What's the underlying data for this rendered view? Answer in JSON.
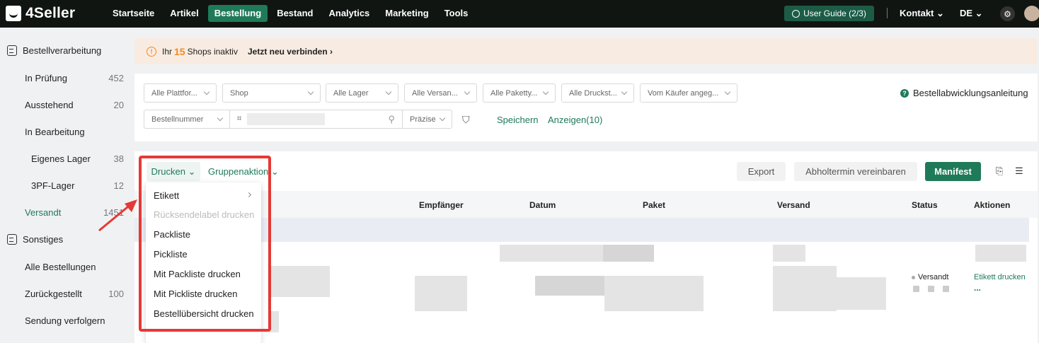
{
  "app": {
    "name": "4Seller"
  },
  "nav": {
    "items": [
      "Startseite",
      "Artikel",
      "Bestellung",
      "Bestand",
      "Analytics",
      "Marketing",
      "Tools"
    ],
    "active": "Bestellung"
  },
  "topbar": {
    "guide": "User Guide (2/3)",
    "contact": "Kontakt",
    "lang": "DE"
  },
  "sidebar": {
    "group1": "Bestellverarbeitung",
    "items": [
      {
        "label": "In Prüfung",
        "count": "452"
      },
      {
        "label": "Ausstehend",
        "count": "20"
      },
      {
        "label": "In Bearbeitung",
        "count": ""
      },
      {
        "label": "Eigenes Lager",
        "count": "38"
      },
      {
        "label": "3PF-Lager",
        "count": "12"
      },
      {
        "label": "Versandt",
        "count": "1451"
      }
    ],
    "group2": "Sonstiges",
    "items2": [
      "Alle Bestellungen",
      "Zurückgestellt",
      "Sendung verfolgern"
    ],
    "zurueck_count": "100"
  },
  "banner": {
    "prefix": "Ihr",
    "count": "15",
    "suffix": "Shops inaktiv",
    "link": "Jetzt neu verbinden"
  },
  "filters": {
    "row1": [
      "Alle Plattfor...",
      "Shop",
      "Alle Lager",
      "Alle Versan...",
      "Alle Paketty...",
      "Alle Druckst...",
      "Vom Käufer angeg..."
    ],
    "search_type": "Bestellnummer",
    "precision": "Präzise",
    "save": "Speichern",
    "show": "Anzeigen(10)",
    "guide": "Bestellabwicklungsanleitung"
  },
  "toolbar": {
    "print": "Drucken",
    "group": "Gruppenaktion",
    "export": "Export",
    "pickup": "Abholtermin vereinbaren",
    "manifest": "Manifest"
  },
  "table": {
    "headers": [
      "Empfänger",
      "Datum",
      "Paket",
      "Versand",
      "Status",
      "Aktionen"
    ],
    "row_status": "Versandt",
    "row_action": "Etikett drucken",
    "row_more": "..."
  },
  "dropdown": {
    "items": [
      "Etikett",
      "Rücksendelabel drucken",
      "Packliste",
      "Pickliste",
      "Mit Packliste drucken",
      "Mit Pickliste drucken",
      "Bestellübersicht drucken"
    ]
  },
  "colors": {
    "brand": "#1f7a5a",
    "warning": "#f08a24",
    "highlight": "#e53935"
  }
}
